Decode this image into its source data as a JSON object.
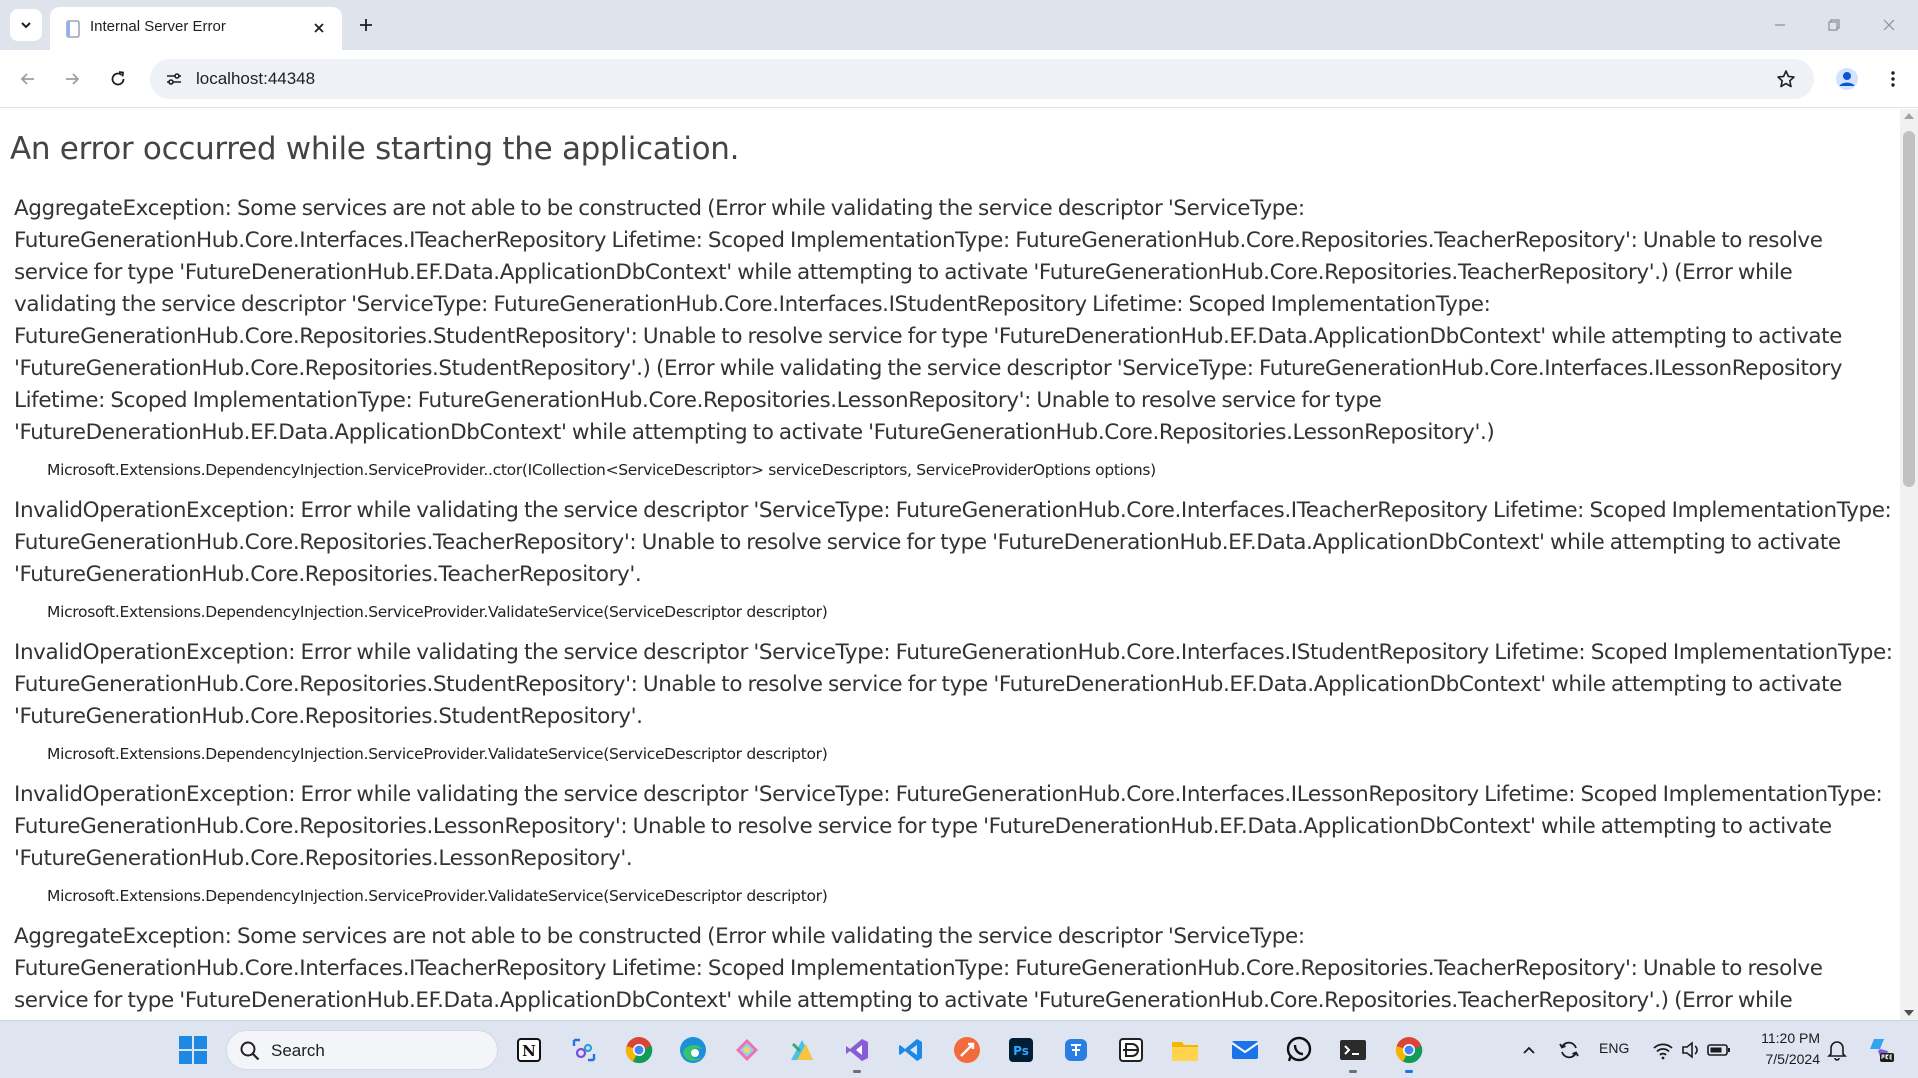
{
  "browser": {
    "tab_title": "Internal Server Error",
    "url": "localhost:44348"
  },
  "page": {
    "title": "An error occurred while starting the application.",
    "errors": [
      {
        "message": "AggregateException: Some services are not able to be constructed (Error while validating the service descriptor 'ServiceType: FutureGenerationHub.Core.Interfaces.ITeacherRepository Lifetime: Scoped ImplementationType: FutureGenerationHub.Core.Repositories.TeacherRepository': Unable to resolve service for type 'FutureDenerationHub.EF.Data.ApplicationDbContext' while attempting to activate 'FutureGenerationHub.Core.Repositories.TeacherRepository'.) (Error while validating the service descriptor 'ServiceType: FutureGenerationHub.Core.Interfaces.IStudentRepository Lifetime: Scoped ImplementationType: FutureGenerationHub.Core.Repositories.StudentRepository': Unable to resolve service for type 'FutureDenerationHub.EF.Data.ApplicationDbContext' while attempting to activate 'FutureGenerationHub.Core.Repositories.StudentRepository'.) (Error while validating the service descriptor 'ServiceType: FutureGenerationHub.Core.Interfaces.ILessonRepository Lifetime: Scoped ImplementationType: FutureGenerationHub.Core.Repositories.LessonRepository': Unable to resolve service for type 'FutureDenerationHub.EF.Data.ApplicationDbContext' while attempting to activate 'FutureGenerationHub.Core.Repositories.LessonRepository'.)",
        "location": "Microsoft.Extensions.DependencyInjection.ServiceProvider..ctor(ICollection<ServiceDescriptor> serviceDescriptors, ServiceProviderOptions options)"
      },
      {
        "message": "InvalidOperationException: Error while validating the service descriptor 'ServiceType: FutureGenerationHub.Core.Interfaces.ITeacherRepository Lifetime: Scoped ImplementationType: FutureGenerationHub.Core.Repositories.TeacherRepository': Unable to resolve service for type 'FutureDenerationHub.EF.Data.ApplicationDbContext' while attempting to activate 'FutureGenerationHub.Core.Repositories.TeacherRepository'.",
        "location": "Microsoft.Extensions.DependencyInjection.ServiceProvider.ValidateService(ServiceDescriptor descriptor)"
      },
      {
        "message": "InvalidOperationException: Error while validating the service descriptor 'ServiceType: FutureGenerationHub.Core.Interfaces.IStudentRepository Lifetime: Scoped ImplementationType: FutureGenerationHub.Core.Repositories.StudentRepository': Unable to resolve service for type 'FutureDenerationHub.EF.Data.ApplicationDbContext' while attempting to activate 'FutureGenerationHub.Core.Repositories.StudentRepository'.",
        "location": "Microsoft.Extensions.DependencyInjection.ServiceProvider.ValidateService(ServiceDescriptor descriptor)"
      },
      {
        "message": "InvalidOperationException: Error while validating the service descriptor 'ServiceType: FutureGenerationHub.Core.Interfaces.ILessonRepository Lifetime: Scoped ImplementationType: FutureGenerationHub.Core.Repositories.LessonRepository': Unable to resolve service for type 'FutureDenerationHub.EF.Data.ApplicationDbContext' while attempting to activate 'FutureGenerationHub.Core.Repositories.LessonRepository'.",
        "location": "Microsoft.Extensions.DependencyInjection.ServiceProvider.ValidateService(ServiceDescriptor descriptor)"
      },
      {
        "message": "AggregateException: Some services are not able to be constructed (Error while validating the service descriptor 'ServiceType: FutureGenerationHub.Core.Interfaces.ITeacherRepository Lifetime: Scoped ImplementationType: FutureGenerationHub.Core.Repositories.TeacherRepository': Unable to resolve service for type 'FutureDenerationHub.EF.Data.ApplicationDbContext' while attempting to activate 'FutureGenerationHub.Core.Repositories.TeacherRepository'.) (Error while validating the service",
        "location": ""
      }
    ]
  },
  "taskbar": {
    "search_label": "Search",
    "language": "ENG",
    "time": "11:20 PM",
    "date": "7/5/2024",
    "apps": [
      "notion-icon",
      "snipping-tool-icon",
      "chrome-icon",
      "edge-icon",
      "copilot-icon",
      "paint-icon",
      "visual-studio-icon",
      "vscode-icon",
      "postman-icon",
      "photoshop-icon",
      "translator-icon",
      "app-icon",
      "file-explorer-icon",
      "mail-icon",
      "whatsapp-icon",
      "terminal-icon",
      "chrome-active-icon"
    ]
  },
  "colors": {
    "tabstrip": "#dfe3eb",
    "omnibox": "#eef1f6",
    "taskbar": "#dee5f1",
    "text": "#333333"
  }
}
